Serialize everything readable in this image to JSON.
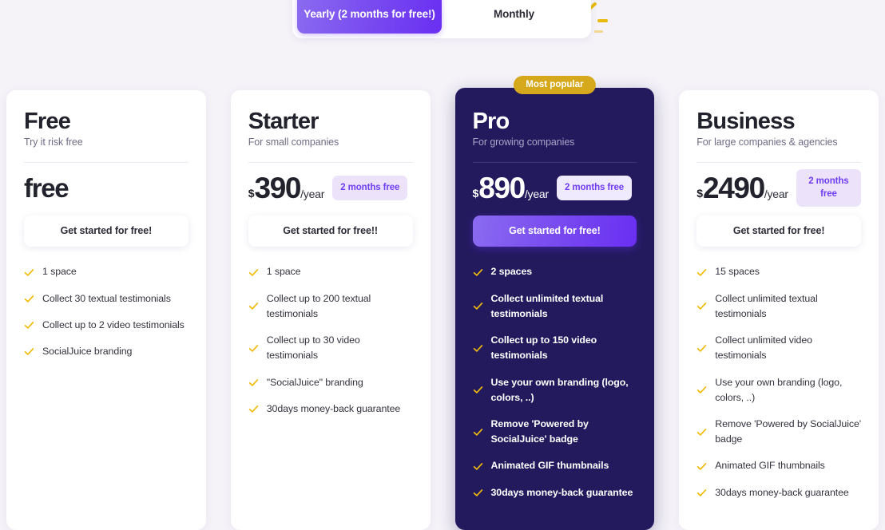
{
  "billing_toggle": {
    "options": [
      {
        "label": "Yearly (2 months for free!)",
        "active": true
      },
      {
        "label": "Monthly",
        "active": false
      }
    ]
  },
  "colors": {
    "page_background": "#f5f3f8",
    "accent_purple": "#6a2ff2",
    "accent_purple_light": "#8b6bf0",
    "featured_card_background": "#231a5e",
    "popular_badge": "#d6a81b",
    "check_yellow": "#f0bb0c",
    "badge_background": "#ece3fb"
  },
  "plans": [
    {
      "name": "Free",
      "tagline": "Try it risk free",
      "currency": "",
      "amount": "free",
      "period": "",
      "months_badge": "",
      "cta_label": "Get started for free!",
      "featured": false,
      "popular_badge": "",
      "features": [
        "1 space",
        "Collect 30 textual testimonials",
        "Collect up to 2 video testimonials",
        "SocialJuice branding"
      ]
    },
    {
      "name": "Starter",
      "tagline": "For small companies",
      "currency": "$",
      "amount": "390",
      "period": "/year",
      "months_badge": "2 months free",
      "cta_label": "Get started for free!!",
      "featured": false,
      "popular_badge": "",
      "features": [
        "1 space",
        "Collect up to 200 textual testimonials",
        "Collect up to 30 video testimonials",
        "\"SocialJuice\" branding",
        "30days money-back guarantee"
      ]
    },
    {
      "name": "Pro",
      "tagline": "For growing companies",
      "currency": "$",
      "amount": "890",
      "period": "/year",
      "months_badge": "2 months free",
      "cta_label": "Get started for free!",
      "featured": true,
      "popular_badge": "Most popular",
      "features": [
        "2 spaces",
        "Collect unlimited textual testimonials",
        "Collect up to 150 video testimonials",
        "Use your own branding (logo, colors, ..)",
        "Remove 'Powered by SocialJuice' badge",
        "Animated GIF thumbnails",
        "30days money-back guarantee"
      ]
    },
    {
      "name": "Business",
      "tagline": "For large companies & agencies",
      "currency": "$",
      "amount": "2490",
      "period": "/year",
      "months_badge": "2 months free",
      "cta_label": "Get started for free!",
      "featured": false,
      "popular_badge": "",
      "features": [
        "15 spaces",
        "Collect unlimited textual testimonials",
        "Collect unlimited video testimonials",
        "Use your own branding (logo, colors, ..)",
        "Remove 'Powered by SocialJuice' badge",
        "Animated GIF thumbnails",
        "30days money-back guarantee"
      ]
    }
  ]
}
